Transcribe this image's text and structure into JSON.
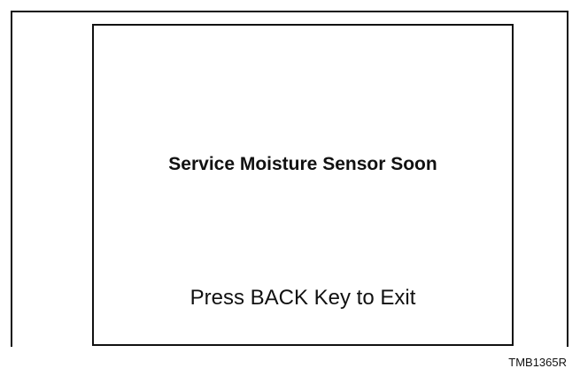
{
  "screen": {
    "warning_message": "Service Moisture Sensor Soon",
    "exit_instruction": "Press BACK Key to Exit"
  },
  "figure": {
    "id": "TMB1365R"
  }
}
